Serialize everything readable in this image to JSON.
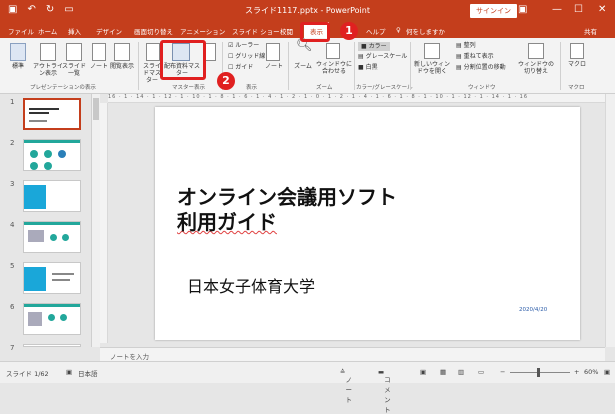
{
  "titlebar": {
    "title": "スライド1117.pptx - PowerPoint",
    "signin": "サインイン",
    "qa_icons": [
      "save-icon",
      "undo-icon",
      "redo-icon",
      "present-icon"
    ]
  },
  "tabs": [
    {
      "label": "ファイル"
    },
    {
      "label": "ホーム"
    },
    {
      "label": "挿入"
    },
    {
      "label": "デザイン"
    },
    {
      "label": "画面切り替え"
    },
    {
      "label": "アニメーション"
    },
    {
      "label": "スライド ショー"
    },
    {
      "label": "校閲"
    },
    {
      "label": "表示",
      "active": true
    },
    {
      "label": "ヘルプ"
    },
    {
      "label": "何をしますか"
    },
    {
      "label": "共有"
    }
  ],
  "ribbon": {
    "views": {
      "normal": "標準",
      "outline": "アウトライン表示",
      "sorter": "スライド一覧",
      "notes": "ノート",
      "reading": "閲覧表示",
      "group": "プレゼンテーションの表示"
    },
    "master": {
      "slide_master": "スライドマスター",
      "handout_master": "配布資料マスター",
      "notes_master": "ノートマスター",
      "group": "マスター表示"
    },
    "show": {
      "ruler": "ルーラー",
      "gridlines": "グリッド線",
      "guides": "ガイド",
      "group": "表示",
      "notes_btn": "ノート"
    },
    "zoom": {
      "zoom": "ズーム",
      "fit": "ウィンドウに合わせる",
      "group": "ズーム"
    },
    "color": {
      "color": "カラー",
      "grayscale": "グレースケール",
      "bw": "白黒",
      "group": "カラー/グレースケール"
    },
    "window": {
      "new_window": "新しいウィンドウを開く",
      "arrange": "整列",
      "cascade": "重ねて表示",
      "split": "分割位置の移動",
      "switch": "ウィンドウの切り替え",
      "group": "ウィンドウ"
    },
    "macro": {
      "macro": "マクロ",
      "group": "マクロ"
    }
  },
  "callouts": {
    "first": "1",
    "second": "2"
  },
  "ruler_text": "16 · 1 · 14 · 1 · 12 · 1 · 10 · 1 · 8 · 1 · 6 · 1 · 4 · 1 · 2 · 1 · 0 · 1 · 2 · 1 · 4 · 1 · 6 · 1 · 8 · 1 · 10 · 1 · 12 · 1 · 14 · 1 · 16",
  "thumbs": [
    {
      "num": "1"
    },
    {
      "num": "2"
    },
    {
      "num": "3"
    },
    {
      "num": "4"
    },
    {
      "num": "5"
    },
    {
      "num": "6"
    },
    {
      "num": "7"
    }
  ],
  "slide": {
    "title_line1": "オンライン会議用ソフト",
    "title_line2": "利用ガイド",
    "subtitle": "日本女子体育大学",
    "date": "2020/4/20"
  },
  "notes_placeholder": "ノートを入力",
  "status": {
    "slide_count": "スライド 1/62",
    "language": "日本語",
    "notes": "ノート",
    "comments": "コメント",
    "zoom": "60%"
  },
  "colors": {
    "accent": "#c43e1c",
    "highlight": "#e02020"
  }
}
